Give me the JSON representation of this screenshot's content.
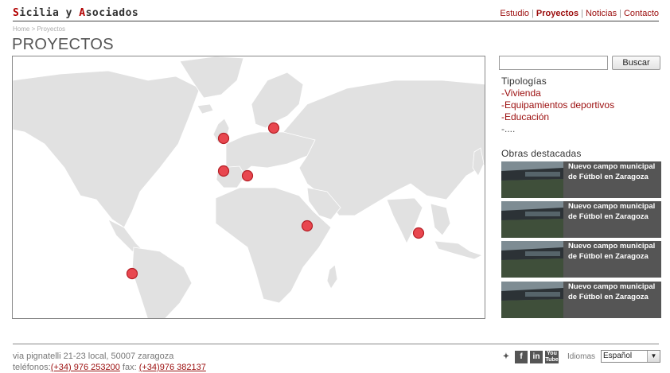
{
  "header": {
    "logo_first": "S",
    "logo_mid": "icilia y ",
    "logo_second": "A",
    "logo_rest": "sociados",
    "nav": [
      {
        "label": "Estudio",
        "active": false
      },
      {
        "label": "Proyectos",
        "active": true
      },
      {
        "label": "Noticias",
        "active": false
      },
      {
        "label": "Contacto",
        "active": false
      }
    ]
  },
  "breadcrumb": "Home > Proyectos",
  "page_title": "PROYECTOS",
  "map": {
    "land_color": "#e1e1e1",
    "water_color": "#ffffff",
    "marker_color": "#e8474f",
    "markers": [
      "uk-ireland",
      "denmark",
      "north-spain",
      "madrid",
      "sudan",
      "india",
      "brazil"
    ]
  },
  "search": {
    "placeholder": "",
    "button": "Buscar"
  },
  "tipologias": {
    "title": "Tipologías",
    "items": [
      "-Vivienda",
      "-Equipamientos deportivos",
      "-Educación"
    ],
    "more": "-...."
  },
  "obras": {
    "title": "Obras destacadas",
    "items": [
      {
        "text": "Nuevo campo municipal de Fútbol en Zaragoza"
      },
      {
        "text": "Nuevo campo municipal de Fútbol en Zaragoza"
      },
      {
        "text": "Nuevo campo municipal de Fútbol en Zaragoza"
      },
      {
        "text": "Nuevo campo municipal de Fútbol en Zaragoza"
      }
    ]
  },
  "footer": {
    "address": "via pignatelli 21-23 local, 50007 zaragoza",
    "phone_label": "teléfonos:",
    "phone": "(+34) 976 253200",
    "fax_label": " fax: ",
    "fax": "(+34)976 382137",
    "social": [
      "twitter-icon",
      "facebook-icon",
      "linkedin-icon",
      "youtube-icon"
    ],
    "idiomas_label": "Idiomas",
    "language": "Español"
  }
}
